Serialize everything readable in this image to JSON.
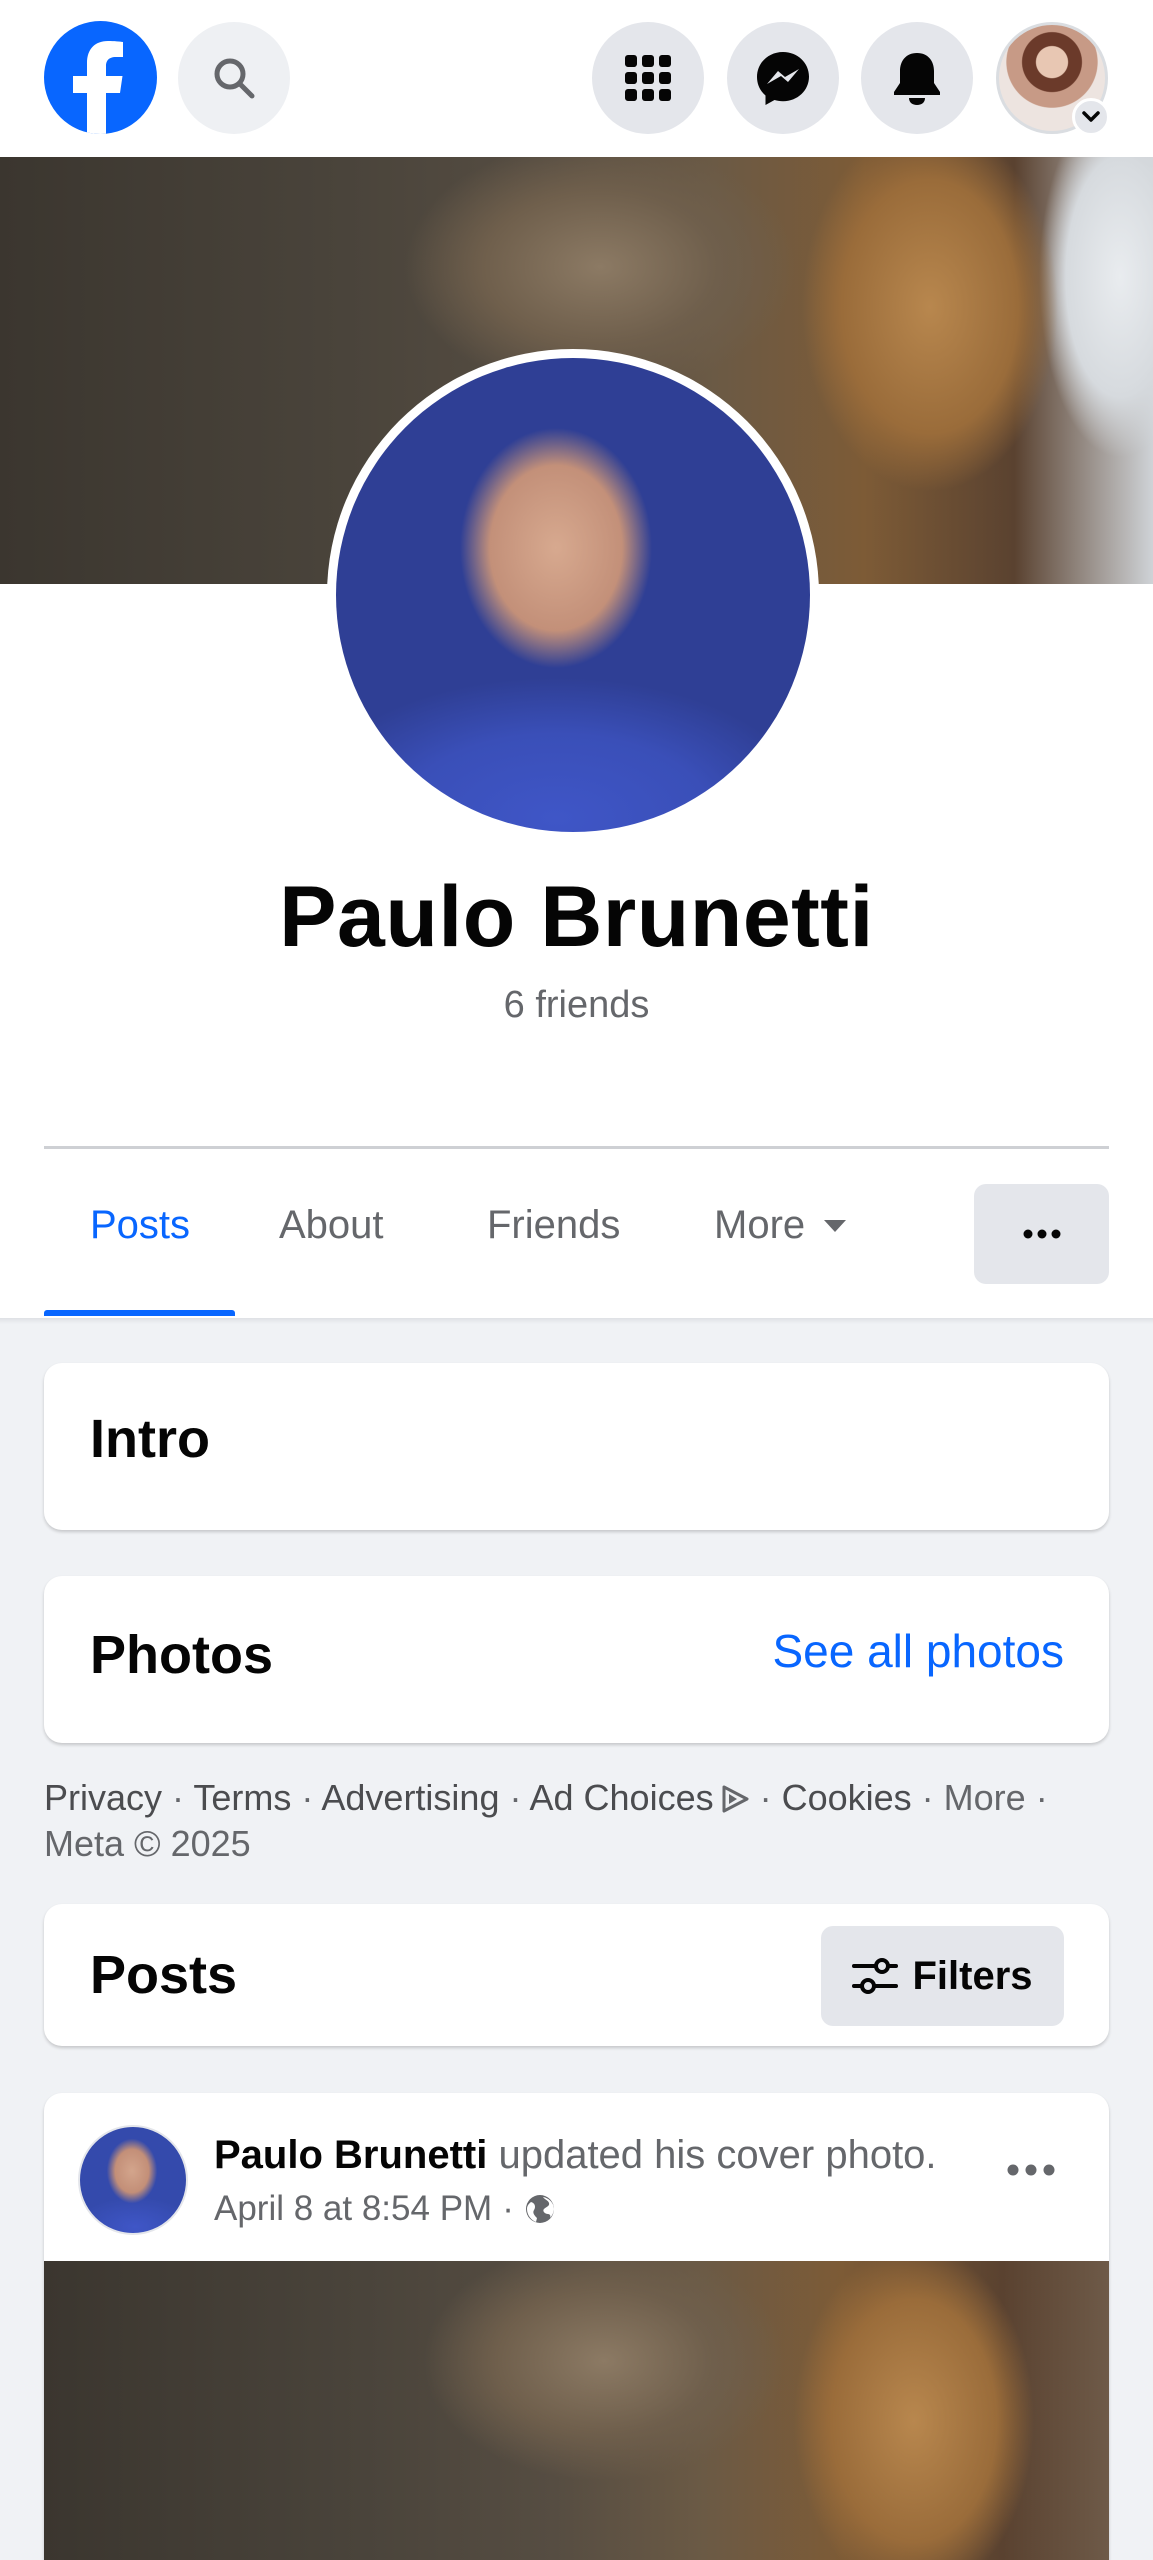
{
  "topbar": {
    "icons": [
      "facebook-logo",
      "search-icon",
      "menu-grid-icon",
      "messenger-icon",
      "bell-icon",
      "avatar",
      "chevron-down-icon"
    ]
  },
  "profile": {
    "name": "Paulo Brunetti",
    "friends": "6 friends"
  },
  "tabs": [
    {
      "label": "Posts",
      "active": true
    },
    {
      "label": "About",
      "active": false
    },
    {
      "label": "Friends",
      "active": false
    },
    {
      "label": "More",
      "active": false
    }
  ],
  "intro": {
    "title": "Intro"
  },
  "photos": {
    "title": "Photos",
    "see_all": "See all photos"
  },
  "footer": {
    "privacy": "Privacy",
    "terms": "Terms",
    "advertising": "Advertising",
    "ad_choices": "Ad Choices",
    "cookies": "Cookies",
    "more": "More",
    "copyright": "Meta © 2025",
    "sep": " · "
  },
  "posts_section": {
    "title": "Posts",
    "filters": "Filters"
  },
  "post": {
    "author": "Paulo Brunetti",
    "action": " updated his cover photo.",
    "timestamp": "April 8 at 8:54 PM",
    "sep": " · ",
    "privacy_icon": "globe-icon"
  },
  "colors": {
    "brand": "#0866ff",
    "text_primary": "#050505",
    "text_secondary": "#65676b",
    "background": "#f0f2f5",
    "button_gray": "#e4e6eb"
  }
}
